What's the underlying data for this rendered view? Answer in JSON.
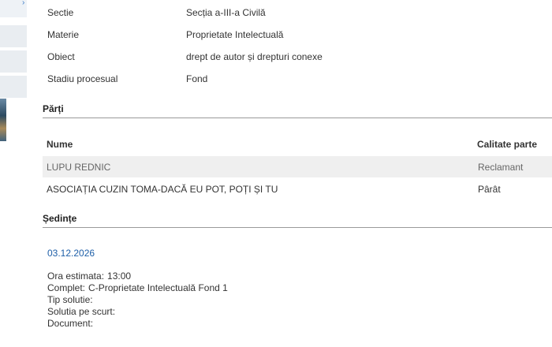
{
  "details": [
    {
      "label": "Sectie",
      "value": "Secția a-III-a Civilă"
    },
    {
      "label": "Materie",
      "value": "Proprietate Intelectuală"
    },
    {
      "label": "Obiect",
      "value": "drept de autor și drepturi conexe"
    },
    {
      "label": "Stadiu procesual",
      "value": "Fond"
    }
  ],
  "parties_section": {
    "title": "Părți",
    "col_name": "Nume",
    "col_role": "Calitate parte",
    "rows": [
      {
        "name": "LUPU REDNIC",
        "role": "Reclamant"
      },
      {
        "name": "ASOCIAȚIA CUZIN TOMA-DACĂ EU POT, POȚI ȘI TU",
        "role": "Pârât"
      }
    ]
  },
  "hearings_section": {
    "title": "Ședințe",
    "date": "03.12.2026",
    "lines": [
      {
        "label": "Ora estimata:",
        "value": "13:00"
      },
      {
        "label": "Complet:",
        "value": "C-Proprietate Intelectuală Fond 1"
      },
      {
        "label": "Tip solutie:",
        "value": ""
      },
      {
        "label": "Solutia pe scurt:",
        "value": ""
      },
      {
        "label": "Document:",
        "value": ""
      }
    ]
  },
  "colors": {
    "link": "#1e5fa8",
    "row_stripe": "#efefef",
    "rule": "#9a9a9a"
  }
}
